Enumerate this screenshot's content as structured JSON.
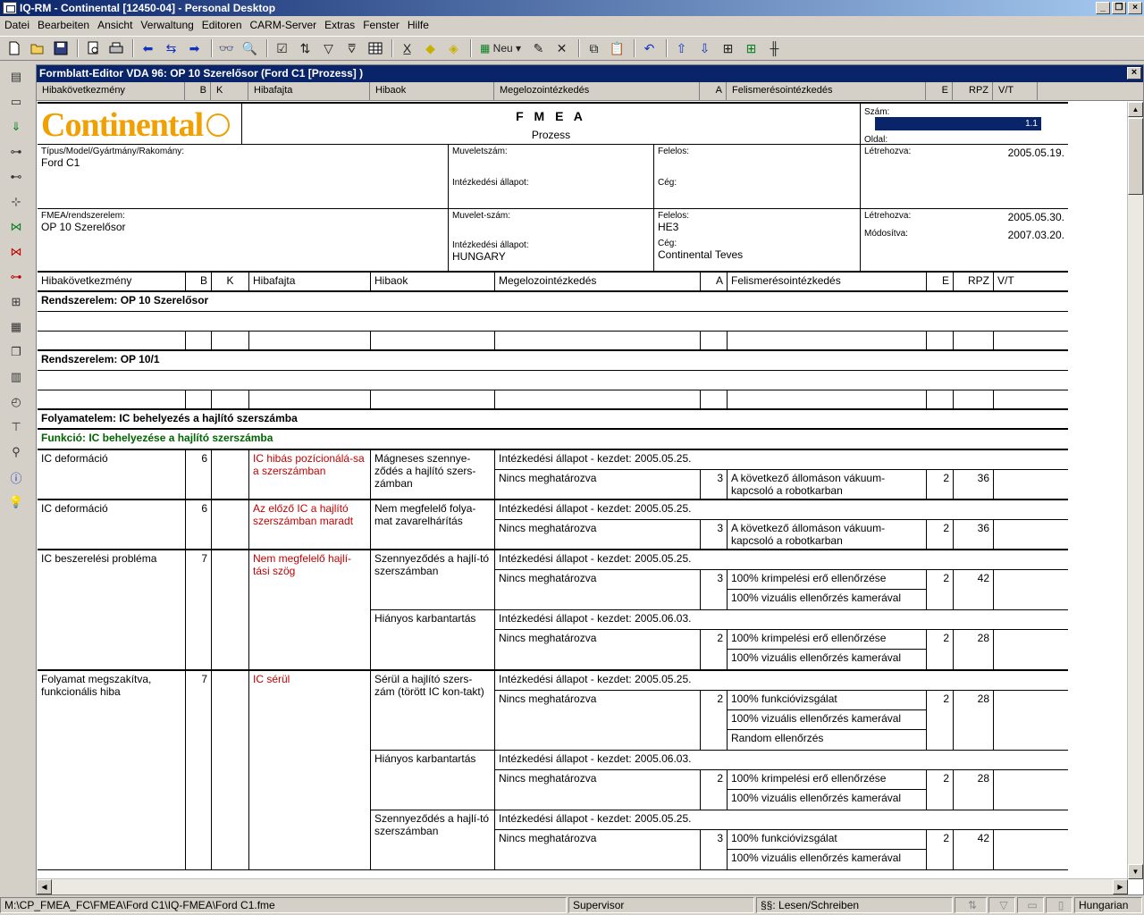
{
  "titlebar": {
    "title": "IQ-RM - Continental [12450-04] - Personal Desktop"
  },
  "menu": [
    "Datei",
    "Bearbeiten",
    "Ansicht",
    "Verwaltung",
    "Editoren",
    "CARM-Server",
    "Extras",
    "Fenster",
    "Hilfe"
  ],
  "toolbar": {
    "neu_label": "Neu"
  },
  "doc": {
    "title": "Formblatt-Editor VDA 96: OP 10 Szerelősor (Ford C1 [Prozess] )",
    "columns": [
      "Hibakövetkezmény",
      "B",
      "K",
      "Hibafajta",
      "Hibaok",
      "Megelozointézkedés",
      "A",
      "Felismerésointézkedés",
      "E",
      "RPZ",
      "V/T"
    ]
  },
  "form": {
    "logo": "Continental",
    "title": "F M E A",
    "subtitle": "Prozess",
    "szam_label": "Szám:",
    "szam_value": "1.1",
    "oldal_label": "Oldal:",
    "tipus_label": "Típus/Model/Gyártmány/Rakomány:",
    "tipus_value": "Ford C1",
    "muveletszam_label": "Muveletszám:",
    "intezkedesi_label": "Intézkedési állapot:",
    "felelos_label": "Felelos:",
    "ceg_label": "Cég:",
    "letrehozva_label": "Létrehozva:",
    "letrehozva_value1": "2005.05.19.",
    "fmea_label": "FMEA/rendszerelem:",
    "fmea_value": "OP 10 Szerelősor",
    "muveletszam2_label": "Muvelet-szám:",
    "intezkedesi2_value": "HUNGARY",
    "felelos2_value": "HE3",
    "ceg2_value": "Continental Teves",
    "letrehozva_value2": "2005.05.30.",
    "modositva_label": "Módosítva:",
    "modositva_value": "2007.03.20.",
    "rendszerelem1": "Rendszerelem: OP 10 Szerelősor",
    "rendszerelem2": "Rendszerelem: OP 10/1",
    "folyamatelem": "Folyamatelem: IC behelyezés a hajlító szerszámba",
    "funkcio": "Funkció: IC behelyezése a hajlító szerszámba"
  },
  "status_prefix": "Intézkedési állapot - kezdet: ",
  "not_defined": "Nincs meghatározva",
  "entries": [
    {
      "kov": "IC deformáció",
      "b": "6",
      "fajta": "IC hibás pozícionálá-sa a szerszámban",
      "causes": [
        {
          "ok": "Mágneses szennye-ződés a hajlító szers-zámban",
          "date": "2005.05.25.",
          "a": "3",
          "e": "2",
          "rpz": "36",
          "det": [
            "A következő állomáson vákuum-kapcsoló a robotkarban"
          ]
        }
      ]
    },
    {
      "kov": "IC deformáció",
      "b": "6",
      "fajta": "Az előző IC a hajlító szerszámban maradt",
      "causes": [
        {
          "ok": "Nem megfelelő folya-mat zavarelhárítás",
          "date": "2005.05.25.",
          "a": "3",
          "e": "2",
          "rpz": "36",
          "det": [
            "A következő állomáson vákuum-kapcsoló a robotkarban"
          ]
        }
      ]
    },
    {
      "kov": "IC beszerelési probléma",
      "b": "7",
      "fajta": "Nem megfelelő hajlí-tási szög",
      "causes": [
        {
          "ok": "Szennyeződés a hajlí-tó szerszámban",
          "date": "2005.05.25.",
          "a": "3",
          "e": "2",
          "rpz": "42",
          "det": [
            "100% krimpelési erő ellenőrzése",
            "100% vizuális ellenőrzés kamerával"
          ]
        },
        {
          "ok": "Hiányos karbantartás",
          "date": "2005.06.03.",
          "a": "2",
          "e": "2",
          "rpz": "28",
          "det": [
            "100% krimpelési erő ellenőrzése",
            "100% vizuális ellenőrzés kamerával"
          ]
        }
      ]
    },
    {
      "kov": "Folyamat megszakítva, funkcionális hiba",
      "b": "7",
      "fajta": "IC sérül",
      "causes": [
        {
          "ok": "Sérül a hajlító szers-zám (törött IC kon-takt)",
          "date": "2005.05.25.",
          "a": "2",
          "e": "2",
          "rpz": "28",
          "det": [
            "100% funkcióvizsgálat",
            "100% vizuális ellenőrzés kamerával",
            "Random ellenőrzés"
          ]
        },
        {
          "ok": "Hiányos karbantartás",
          "date": "2005.06.03.",
          "a": "2",
          "e": "2",
          "rpz": "28",
          "det": [
            "100% krimpelési erő ellenőrzése",
            "100% vizuális ellenőrzés kamerával"
          ]
        },
        {
          "ok": "Szennyeződés a hajlí-tó szerszámban",
          "date": "2005.05.25.",
          "a": "3",
          "e": "2",
          "rpz": "42",
          "det": [
            "100% funkcióvizsgálat",
            "100% vizuális ellenőrzés kamerával"
          ]
        }
      ]
    }
  ],
  "statusbar": {
    "path": "M:\\CP_FMEA_FC\\FMEA\\Ford C1\\IQ-FMEA\\Ford C1.fme",
    "user": "Supervisor",
    "mode": "§§: Lesen/Schreiben",
    "language": "Hungarian"
  }
}
